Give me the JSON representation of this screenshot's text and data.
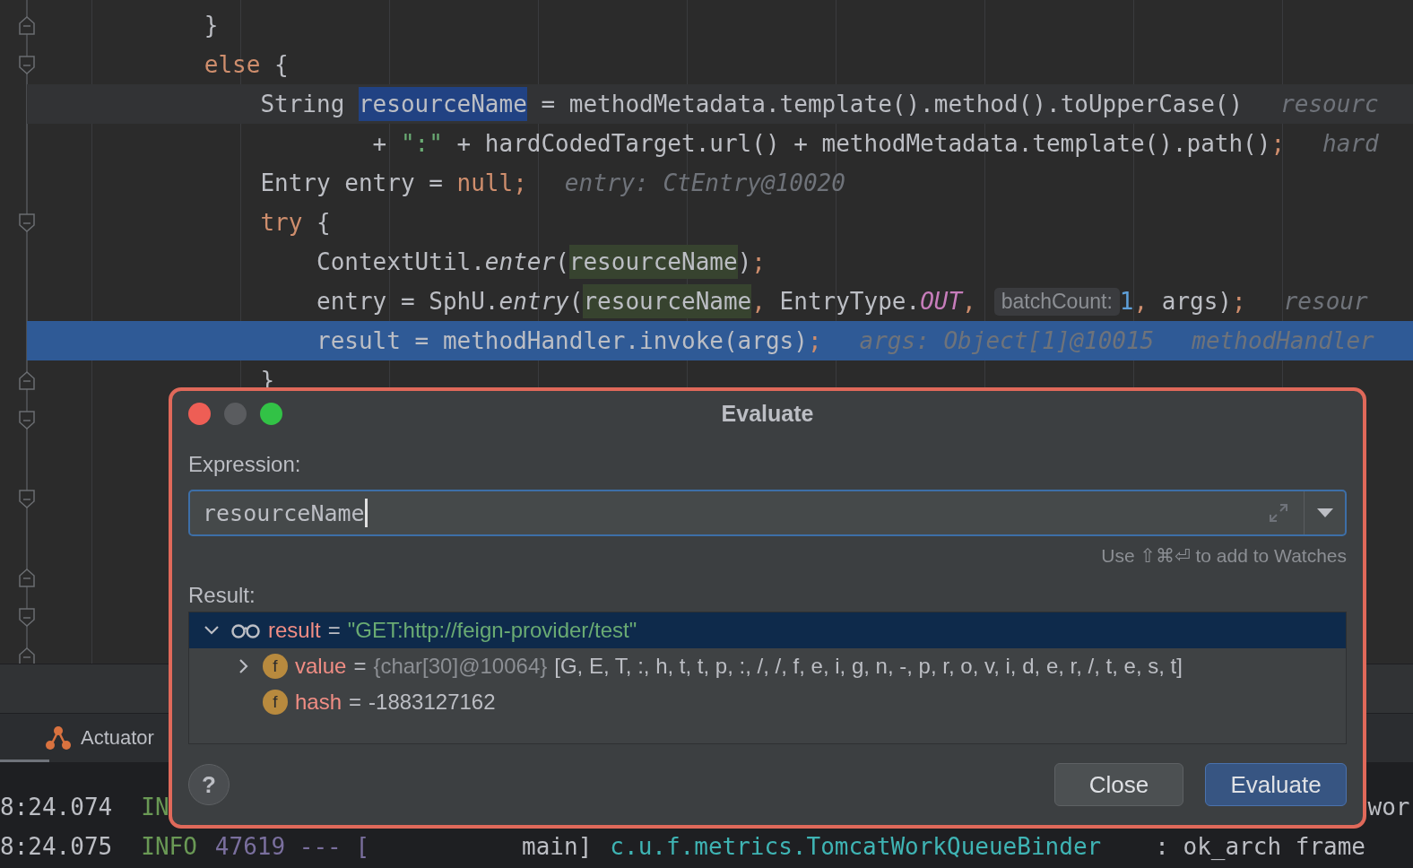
{
  "editor": {
    "lines": [
      {
        "fold_end": true,
        "tokens": [
          {
            "kind": "plain",
            "t": "}"
          }
        ]
      },
      {
        "fold_start": true,
        "tokens": [
          {
            "kind": "keyword",
            "t": "else"
          },
          {
            "kind": "plain",
            "t": " {"
          }
        ]
      },
      {
        "caret": true,
        "tokens": [
          {
            "kind": "plain",
            "t": "String "
          },
          {
            "kind": "selection",
            "t": "resourceName"
          },
          {
            "kind": "plain",
            "t": " = methodMetadata.template().method().toUpperCase()"
          },
          {
            "kind": "hint",
            "t": "resourc"
          }
        ]
      },
      {
        "tokens": [
          {
            "kind": "plain",
            "t": "+ "
          },
          {
            "kind": "string",
            "t": "\":\""
          },
          {
            "kind": "plain",
            "t": " + hardCodedTarget.url() + methodMetadata.template().path()"
          },
          {
            "kind": "keyword",
            "t": ";"
          },
          {
            "kind": "hint",
            "t": "hard"
          }
        ]
      },
      {
        "tokens": [
          {
            "kind": "plain",
            "t": "Entry entry = "
          },
          {
            "kind": "keyword",
            "t": "null;"
          },
          {
            "kind": "hint",
            "t": "entry: CtEntry@10020"
          }
        ]
      },
      {
        "fold_start": true,
        "tokens": [
          {
            "kind": "keyword",
            "t": "try"
          },
          {
            "kind": "plain",
            "t": " {"
          }
        ]
      },
      {
        "tokens": [
          {
            "kind": "plain",
            "t": "ContextUtil."
          },
          {
            "kind": "italic",
            "t": "enter"
          },
          {
            "kind": "plain",
            "t": "("
          },
          {
            "kind": "usage",
            "t": "resourceName"
          },
          {
            "kind": "plain",
            "t": ")"
          },
          {
            "kind": "keyword",
            "t": ";"
          }
        ]
      },
      {
        "tokens": [
          {
            "kind": "plain",
            "t": "entry = SphU."
          },
          {
            "kind": "italic",
            "t": "entry"
          },
          {
            "kind": "plain",
            "t": "("
          },
          {
            "kind": "usage",
            "t": "resourceName"
          },
          {
            "kind": "keyword",
            "t": ","
          },
          {
            "kind": "plain",
            "t": " EntryType."
          },
          {
            "kind": "constant",
            "t": "OUT"
          },
          {
            "kind": "keyword",
            "t": ","
          },
          {
            "kind": "inlay",
            "t": "batchCount:"
          },
          {
            "kind": "number",
            "t": "1"
          },
          {
            "kind": "keyword",
            "t": ","
          },
          {
            "kind": "plain",
            "t": " args)"
          },
          {
            "kind": "keyword",
            "t": ";"
          },
          {
            "kind": "hint",
            "t": "resour"
          }
        ]
      },
      {
        "execution": true,
        "tokens": [
          {
            "kind": "plain",
            "t": "result = methodHandler.invoke(args)"
          },
          {
            "kind": "keyword",
            "t": ";"
          },
          {
            "kind": "hint",
            "t": "args: Object[1]@10015"
          },
          {
            "kind": "hint",
            "t": "methodHandler"
          }
        ]
      },
      {
        "fold_end": true,
        "tokens": [
          {
            "kind": "plain",
            "t": "}"
          }
        ]
      },
      {
        "fold_start": true
      },
      {
        "fold_start": false
      },
      {
        "fold_start": true
      },
      {
        "fold_start": false
      },
      {
        "fold_end": true
      },
      {
        "fold_start": true
      },
      {
        "fold_end": true
      }
    ]
  },
  "tool_tabs": [
    {
      "label": "Actuator"
    }
  ],
  "console": {
    "lines": [
      {
        "time": "8:24.074",
        "level": "IN",
        "tail": "wor"
      },
      {
        "time": "8:24.075",
        "level": "INFO",
        "pid": "47619 --- [",
        "thread": "main]",
        "logger": "c.u.f.metrics.TomcatWorkQueueBinder",
        "tail": ": ok_arch frame"
      }
    ]
  },
  "dialog": {
    "title": "Evaluate",
    "expression_label": "Expression:",
    "expression": "resourceName",
    "hint": "Use ⇧⌘⏎ to add to Watches",
    "result_label": "Result:",
    "tree": [
      {
        "kind": "watch",
        "name": "result",
        "eq": "=",
        "value": "\"GET:http://feign-provider/test\"",
        "expanded": true,
        "selected": true,
        "children": [
          {
            "kind": "field",
            "badge": "f",
            "name": "value",
            "eq": "=",
            "type": "{char[30]@10064}",
            "value": "[G, E, T, :, h, t, t, p, :, /, /, f, e, i, g, n, -, p, r, o, v, i, d, e, r, /, t, e, s, t]",
            "expanded": false,
            "selected": false
          },
          {
            "kind": "field",
            "badge": "f",
            "name": "hash",
            "eq": "=",
            "value": "-1883127162",
            "selected": false
          }
        ]
      }
    ],
    "help": "?",
    "buttons": [
      {
        "label": "Close",
        "primary": false
      },
      {
        "label": "Evaluate",
        "primary": true
      }
    ]
  }
}
